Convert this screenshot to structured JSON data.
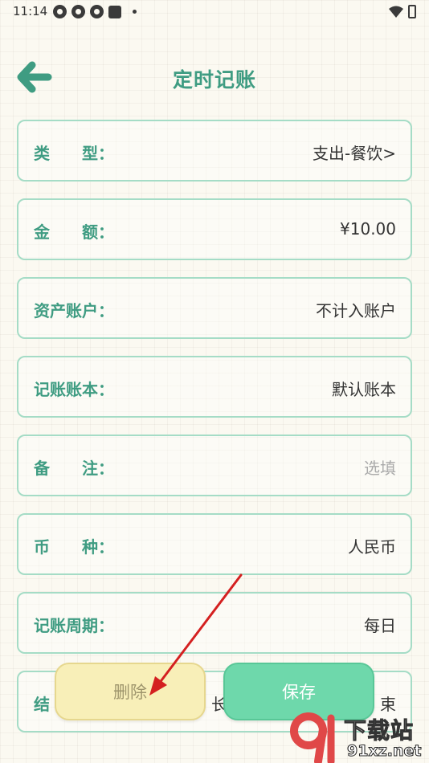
{
  "status_bar": {
    "time": "11:14",
    "icons": [
      "notification-icon",
      "notification-icon",
      "notification-icon",
      "app-square-icon",
      "dot-icon",
      "wifi-icon",
      "battery-icon"
    ]
  },
  "header": {
    "title": "定时记账",
    "back_icon": "arrow-left-icon",
    "accent_color": "#3f9c82"
  },
  "form": {
    "rows": [
      {
        "label": "类　　型：",
        "value": "支出-餐饮>"
      },
      {
        "label": "金　　额：",
        "value": "¥10.00"
      },
      {
        "label": "资产账户：",
        "value": "不计入账户"
      },
      {
        "label": "记账账本：",
        "value": "默认账本"
      },
      {
        "label": "备　　注：",
        "value": "选填"
      },
      {
        "label": "币　　种：",
        "value": "人民币"
      },
      {
        "label": "记账周期：",
        "value": "每日"
      },
      {
        "label": "结",
        "value_left": "长",
        "value": "束"
      }
    ]
  },
  "actions": {
    "delete_label": "删除",
    "save_label": "保存"
  },
  "colors": {
    "row_border": "#a5dcc6",
    "save_button": "#6ed8ab",
    "delete_button": "#f8efb8",
    "annotation_arrow": "#d42020"
  },
  "watermark": {
    "title": "下载站",
    "url": "91xz.net"
  }
}
